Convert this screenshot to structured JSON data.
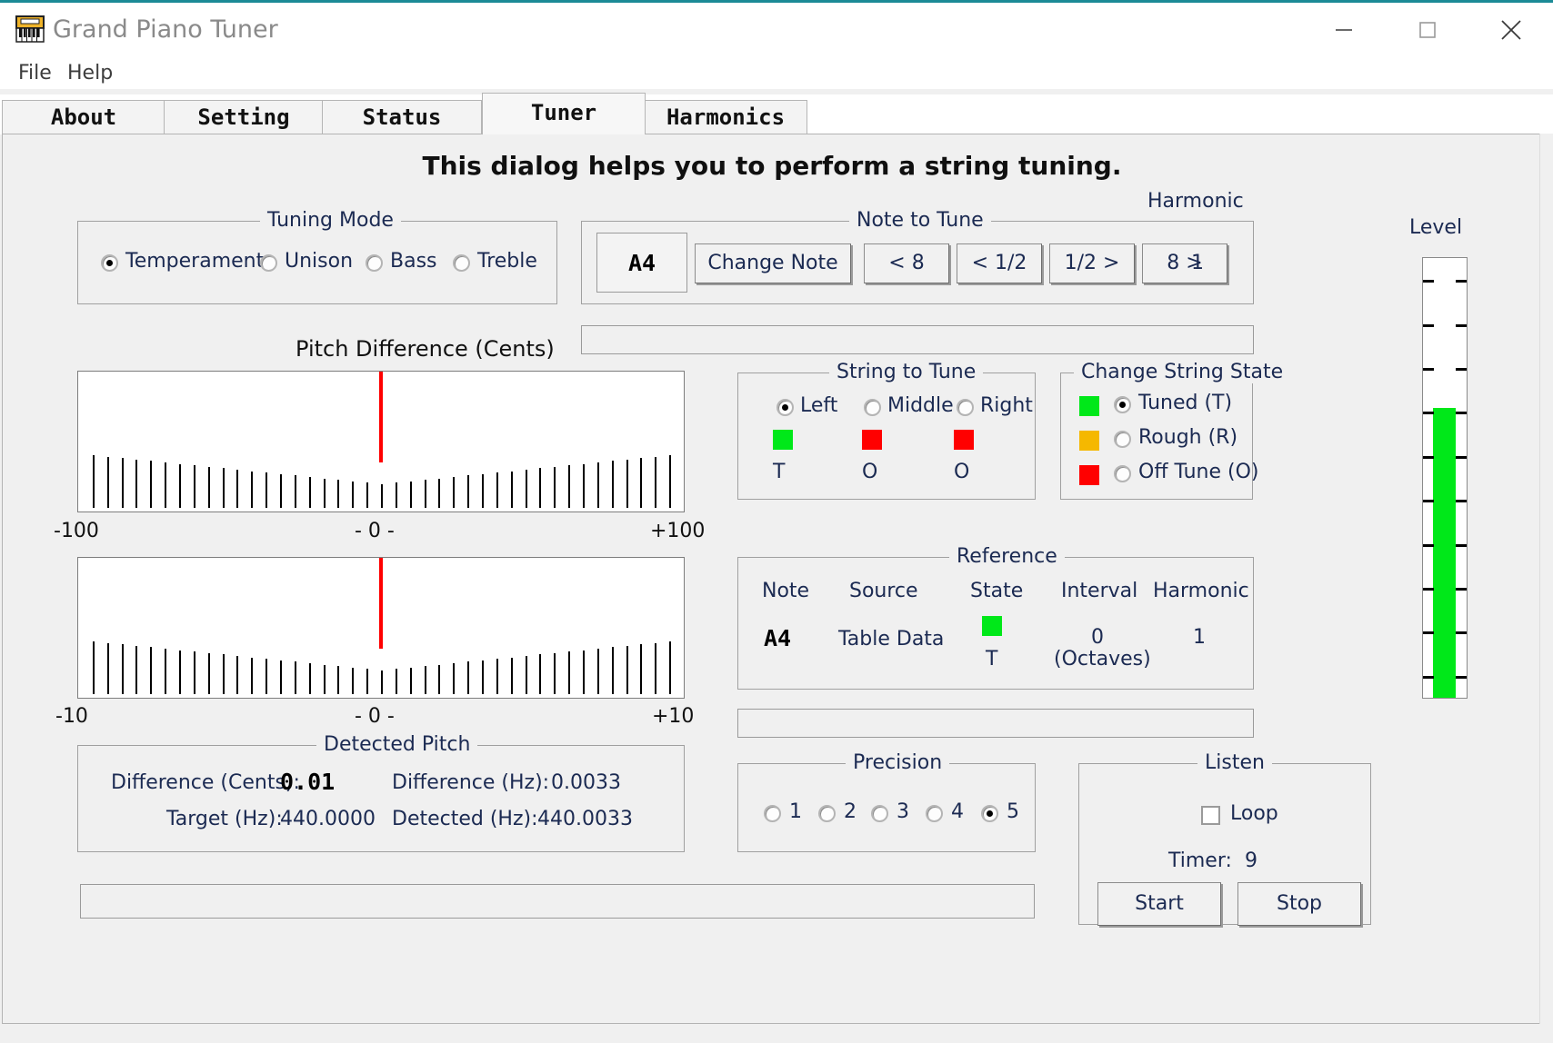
{
  "window": {
    "title": "Grand Piano Tuner",
    "icon": "piano-icon",
    "minimize": "minimize-icon",
    "maximize": "maximize-icon",
    "close": "close-icon"
  },
  "menu": {
    "items": [
      "File",
      "Help"
    ]
  },
  "tabs": {
    "items": [
      "About",
      "Setting",
      "Status",
      "Tuner",
      "Harmonics"
    ],
    "active": "Tuner"
  },
  "headline": "This dialog helps you to perform a string tuning.",
  "tuning_mode": {
    "legend": "Tuning Mode",
    "options": [
      "Temperament",
      "Unison",
      "Bass",
      "Treble"
    ],
    "selected": "Temperament"
  },
  "note_to_tune": {
    "legend": "Note to Tune",
    "note": "A4",
    "buttons": [
      "Change Note",
      "< 8",
      "< 1/2",
      "1/2 >",
      "8 >"
    ],
    "harmonic_label": "Harmonic",
    "harmonic_value": "1"
  },
  "pitch_difference": {
    "title": "Pitch Difference (Cents)",
    "coarse": {
      "min": "-100",
      "center": "- 0 -",
      "max": "+100",
      "needle_pct": 50
    },
    "fine": {
      "min": "-10",
      "center": "- 0 -",
      "max": "+10",
      "needle_pct": 50
    }
  },
  "string_to_tune": {
    "legend": "String to Tune",
    "options": [
      "Left",
      "Middle",
      "Right"
    ],
    "selected": "Left",
    "swatches": [
      "#00e819",
      "#ff0000",
      "#ff0000"
    ],
    "states": [
      "T",
      "O",
      "O"
    ]
  },
  "change_string_state": {
    "legend": "Change String State",
    "options": [
      {
        "label": "Tuned (T)",
        "color": "#00e819"
      },
      {
        "label": "Rough (R)",
        "color": "#f5b800"
      },
      {
        "label": "Off Tune (O)",
        "color": "#ff0000"
      }
    ],
    "selected": "Tuned (T)"
  },
  "reference": {
    "legend": "Reference",
    "headers": [
      "Note",
      "Source",
      "State",
      "Interval",
      "Harmonic"
    ],
    "note": "A4",
    "source": "Table Data",
    "state_color": "#00e819",
    "state_letter": "T",
    "interval": "0",
    "interval_unit": "(Octaves)",
    "harmonic": "1"
  },
  "detected_pitch": {
    "legend": "Detected Pitch",
    "difference_cents_label": "Difference (Cents):",
    "difference_cents_value": "0.01",
    "difference_hz_label": "Difference (Hz):",
    "difference_hz_value": "0.0033",
    "target_hz_label": "Target (Hz):",
    "target_hz_value": "440.0000",
    "detected_hz_label": "Detected (Hz):",
    "detected_hz_value": "440.0033"
  },
  "precision": {
    "legend": "Precision",
    "options": [
      "1",
      "2",
      "3",
      "4",
      "5"
    ],
    "selected": "5"
  },
  "listen": {
    "legend": "Listen",
    "loop_label": "Loop",
    "loop_checked": false,
    "timer_label": "Timer:",
    "timer_value": "9",
    "start_label": "Start",
    "stop_label": "Stop"
  },
  "level": {
    "label": "Level",
    "fill_pct": 66
  }
}
